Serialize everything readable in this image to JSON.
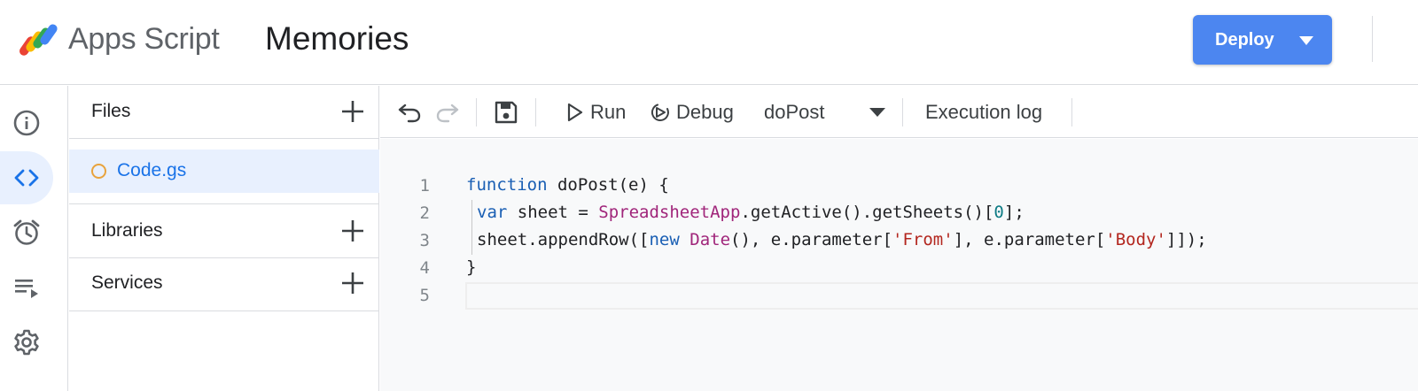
{
  "header": {
    "app_name": "Apps Script",
    "project_title": "Memories",
    "deploy_label": "Deploy",
    "deploy_caret_icon": "caret-down-icon",
    "accent_color": "#4c86f0"
  },
  "rail": {
    "items": [
      {
        "icon": "info-icon",
        "active": false
      },
      {
        "icon": "code-icon",
        "active": true
      },
      {
        "icon": "alarm-clock-icon",
        "active": false
      },
      {
        "icon": "executions-list-icon",
        "active": false
      },
      {
        "icon": "gear-icon",
        "active": false
      }
    ]
  },
  "files_panel": {
    "files_title": "Files",
    "file_name": "Code.gs",
    "libraries_title": "Libraries",
    "services_title": "Services"
  },
  "toolbar": {
    "run_label": "Run",
    "debug_label": "Debug",
    "function_selected": "doPost",
    "execution_log_label": "Execution log"
  },
  "editor": {
    "line_numbers": [
      "1",
      "2",
      "3",
      "4",
      "5"
    ],
    "lines": [
      "function doPost(e) {",
      "var sheet = SpreadsheetApp.getActive().getSheets()[0];",
      "sheet.appendRow([new Date(), e.parameter['From'], e.parameter['Body']]);",
      "}",
      ""
    ]
  }
}
